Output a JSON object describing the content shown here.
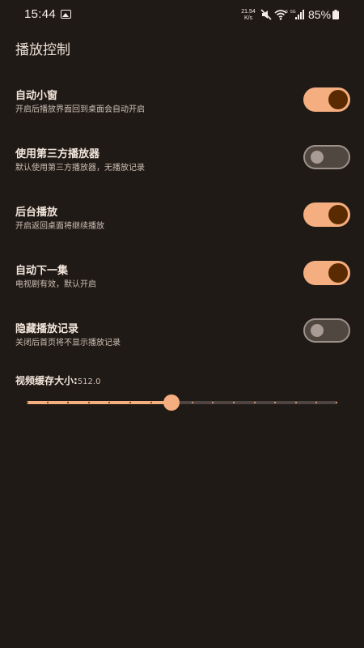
{
  "status_bar": {
    "time": "15:44",
    "net_speed_value": "21.54",
    "net_speed_unit": "K/s",
    "battery": "85%"
  },
  "page": {
    "title": "播放控制"
  },
  "settings": [
    {
      "title": "自动小窗",
      "subtitle": "开启后播放界面回到桌面会自动开启",
      "enabled": true
    },
    {
      "title": "使用第三方播放器",
      "subtitle": "默认使用第三方播放器，无播放记录",
      "enabled": false
    },
    {
      "title": "后台播放",
      "subtitle": "开启返回桌面将继续播放",
      "enabled": true
    },
    {
      "title": "自动下一集",
      "subtitle": "电视剧有效，默认开启",
      "enabled": true
    },
    {
      "title": "隐藏播放记录",
      "subtitle": "关闭后首页将不显示播放记录",
      "enabled": false
    }
  ],
  "cache": {
    "label": "视频缓存大小:",
    "value": "512.0",
    "fraction": 0.467,
    "steps": 16
  },
  "colors": {
    "accent": "#f5ae7f",
    "knob_on": "#5a2b00",
    "background": "#201a16",
    "track_inactive": "#4f4540"
  }
}
